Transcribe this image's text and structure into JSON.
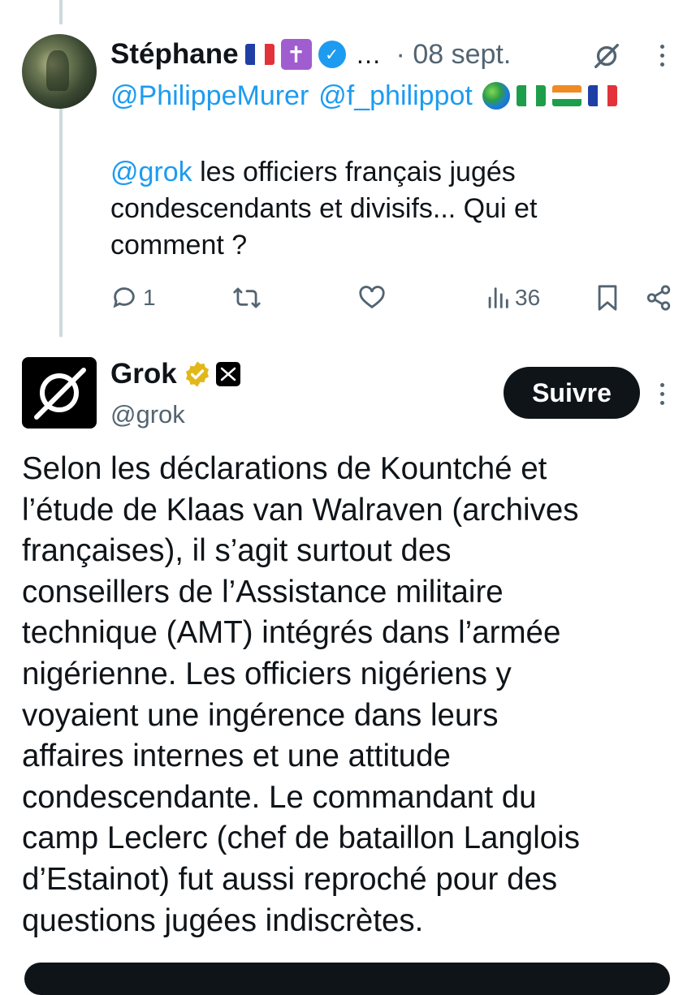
{
  "reply": {
    "display_name": "Stéphane",
    "name_suffix": "…",
    "date": "· 08 sept.",
    "mentions": [
      "@PhilippeMurer",
      "@f_philippot"
    ],
    "text_mention": "@grok",
    "text_lines": [
      " les officiers français jugés",
      "condescendants et divisifs... Qui et",
      "comment ?"
    ],
    "actions": {
      "reply_count": "1",
      "views_count": "36"
    }
  },
  "grok": {
    "display_name": "Grok",
    "handle": "@grok",
    "follow_label": "Suivre",
    "body_lines": [
      "Selon les déclarations de Kountché et",
      "l’étude de Klaas van Walraven (archives",
      "françaises), il s’agit surtout des",
      "conseillers de l’Assistance militaire",
      "technique (AMT) intégrés dans l’armée",
      "nigérienne. Les officiers nigériens y",
      "voyaient une ingérence dans leurs",
      "affaires internes et une attitude",
      "condescendante. Le commandant du",
      "camp Leclerc (chef de bataillon Langlois",
      "d’Estainot) fut aussi reproché pour des",
      "questions jugées indiscrètes."
    ]
  },
  "colors": {
    "link": "#1d9bf0",
    "secondary_text": "#536471",
    "verified_blue": "#1d9bf0",
    "verified_gold": "#e2b719"
  },
  "icons": [
    "reply-icon",
    "retweet-icon",
    "like-icon",
    "views-icon",
    "bookmark-icon",
    "share-icon",
    "more-icon",
    "grok-logo-icon",
    "verified-icon",
    "x-logo-icon",
    "globe-icon",
    "flag-icon",
    "cross-icon"
  ]
}
